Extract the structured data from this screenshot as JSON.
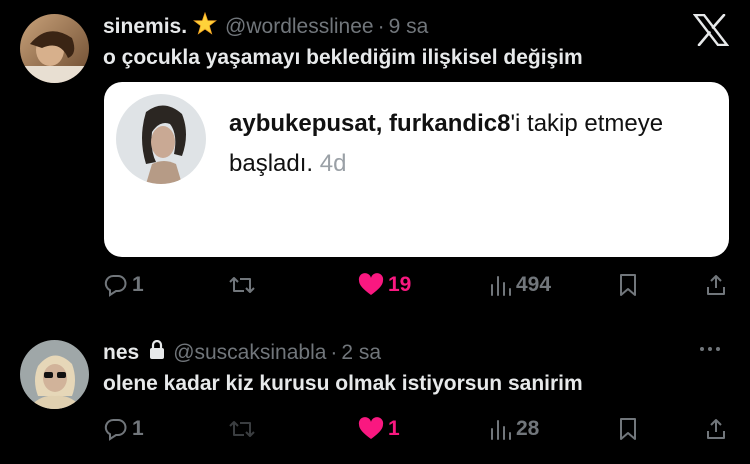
{
  "tweet1": {
    "display_name": "sinemis.",
    "handle": "@wordlesslinee",
    "time": "9 sa",
    "text": "o çocukla yaşamayı beklediğim ilişkisel değişim",
    "quote": {
      "names": "aybukepusat, furkandic8",
      "suffix": "'i takip etmeye",
      "line2": "başladı.",
      "age": "4d"
    },
    "actions": {
      "replies": "1",
      "likes": "19",
      "views": "494"
    }
  },
  "tweet2": {
    "display_name": "nes",
    "handle": "@suscaksinabla",
    "time": "2 sa",
    "text": "olene kadar kiz kurusu olmak istiyorsun sanirim",
    "actions": {
      "replies": "1",
      "likes": "1",
      "views": "28"
    }
  },
  "colors": {
    "background": "#000000",
    "text": "#e7e9ea",
    "muted": "#71767b",
    "like": "#f91880"
  },
  "icons": [
    "x-logo-icon",
    "reply-icon",
    "retweet-icon",
    "heart-icon",
    "views-icon",
    "bookmark-icon",
    "share-icon",
    "lock-icon",
    "star-emoji-icon",
    "more-icon"
  ]
}
